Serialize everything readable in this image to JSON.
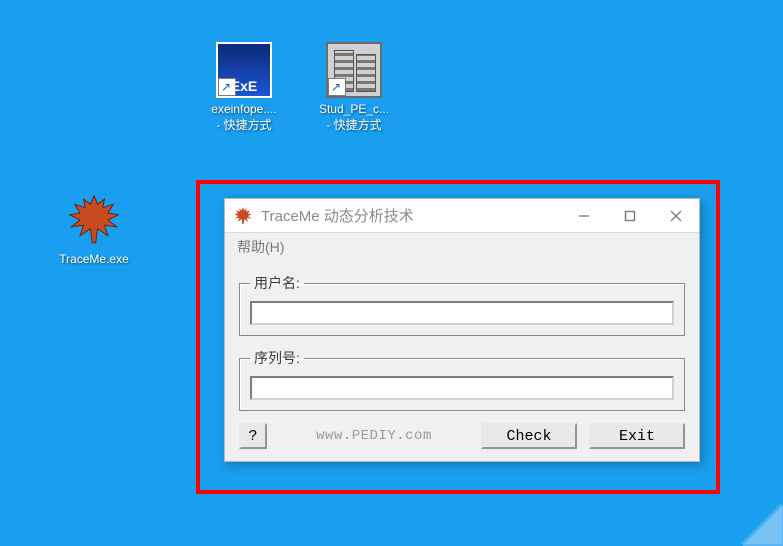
{
  "desktop": {
    "icons": [
      {
        "line1": "exeinfope....",
        "line2": "- 快捷方式"
      },
      {
        "line1": "Stud_PE_c...",
        "line2": "- 快捷方式"
      },
      {
        "line1": "TraceMe.exe",
        "line2": ""
      }
    ]
  },
  "window": {
    "title": "TraceMe 动态分析技术",
    "menu": {
      "help": "帮助(H)"
    },
    "groups": {
      "username_label": "用户名:",
      "serial_label": "序列号:",
      "username_value": "",
      "serial_value": ""
    },
    "buttons": {
      "help": "?",
      "check": "Check",
      "exit": "Exit"
    },
    "link_text": "www.PEDIY.com"
  }
}
